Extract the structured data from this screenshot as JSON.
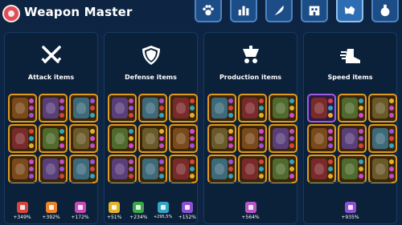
{
  "header": {
    "title": "Weapon Master",
    "tabs": [
      {
        "icon": "paw-icon",
        "active": false
      },
      {
        "icon": "bar-chart-icon",
        "active": false
      },
      {
        "icon": "feather-icon",
        "active": false
      },
      {
        "icon": "building-icon",
        "active": false
      },
      {
        "icon": "wolf-icon",
        "active": true
      },
      {
        "icon": "potion-icon",
        "active": false
      }
    ]
  },
  "colors": {
    "background": "#0d2542",
    "panel": "#0b2039",
    "gold_frame": "#e09a1c",
    "purple_frame": "#9e5de0",
    "active_tab": "#2f6db3"
  },
  "panels": [
    {
      "title": "Attack items",
      "icon": "crossed-swords-icon",
      "items": [
        "gold",
        "gold",
        "gold",
        "gold",
        "gold",
        "gold",
        "gold",
        "gold",
        "gold"
      ],
      "bonuses": [
        {
          "icon": "sword-icon",
          "color": "#d6453d",
          "value": "+349%"
        },
        {
          "icon": "axe-icon",
          "color": "#e7842b",
          "value": "+392%"
        },
        {
          "icon": "crossbow-icon",
          "color": "#c54ab7",
          "value": "+172%"
        }
      ]
    },
    {
      "title": "Defense items",
      "icon": "shield-icon",
      "items": [
        "gold",
        "gold",
        "gold",
        "gold",
        "gold",
        "gold",
        "gold",
        "gold",
        "gold"
      ],
      "bonuses": [
        {
          "icon": "helmet-icon",
          "color": "#e0b32a",
          "value": "+51%"
        },
        {
          "icon": "armor-icon",
          "color": "#3aa64a",
          "value": "+234%"
        },
        {
          "icon": "shield-small-icon",
          "color": "#33a3c6",
          "value": "+295,5%"
        },
        {
          "icon": "boots-icon",
          "color": "#8d4fd0",
          "value": "+152%"
        }
      ]
    },
    {
      "title": "Production items",
      "icon": "production-icon",
      "items": [
        "gold",
        "gold",
        "gold",
        "gold",
        "gold",
        "gold",
        "gold",
        "gold",
        "gold"
      ],
      "bonuses": [
        {
          "icon": "chest-icon",
          "color": "#b457c7",
          "value": "+564%"
        }
      ]
    },
    {
      "title": "Speed items",
      "icon": "winged-boot-icon",
      "items": [
        "purple",
        "gold",
        "gold",
        "gold",
        "gold",
        "gold",
        "gold",
        "gold",
        "gold"
      ],
      "bonuses": [
        {
          "icon": "speed-icon",
          "color": "#8d4fd0",
          "value": "+935%"
        }
      ]
    }
  ]
}
